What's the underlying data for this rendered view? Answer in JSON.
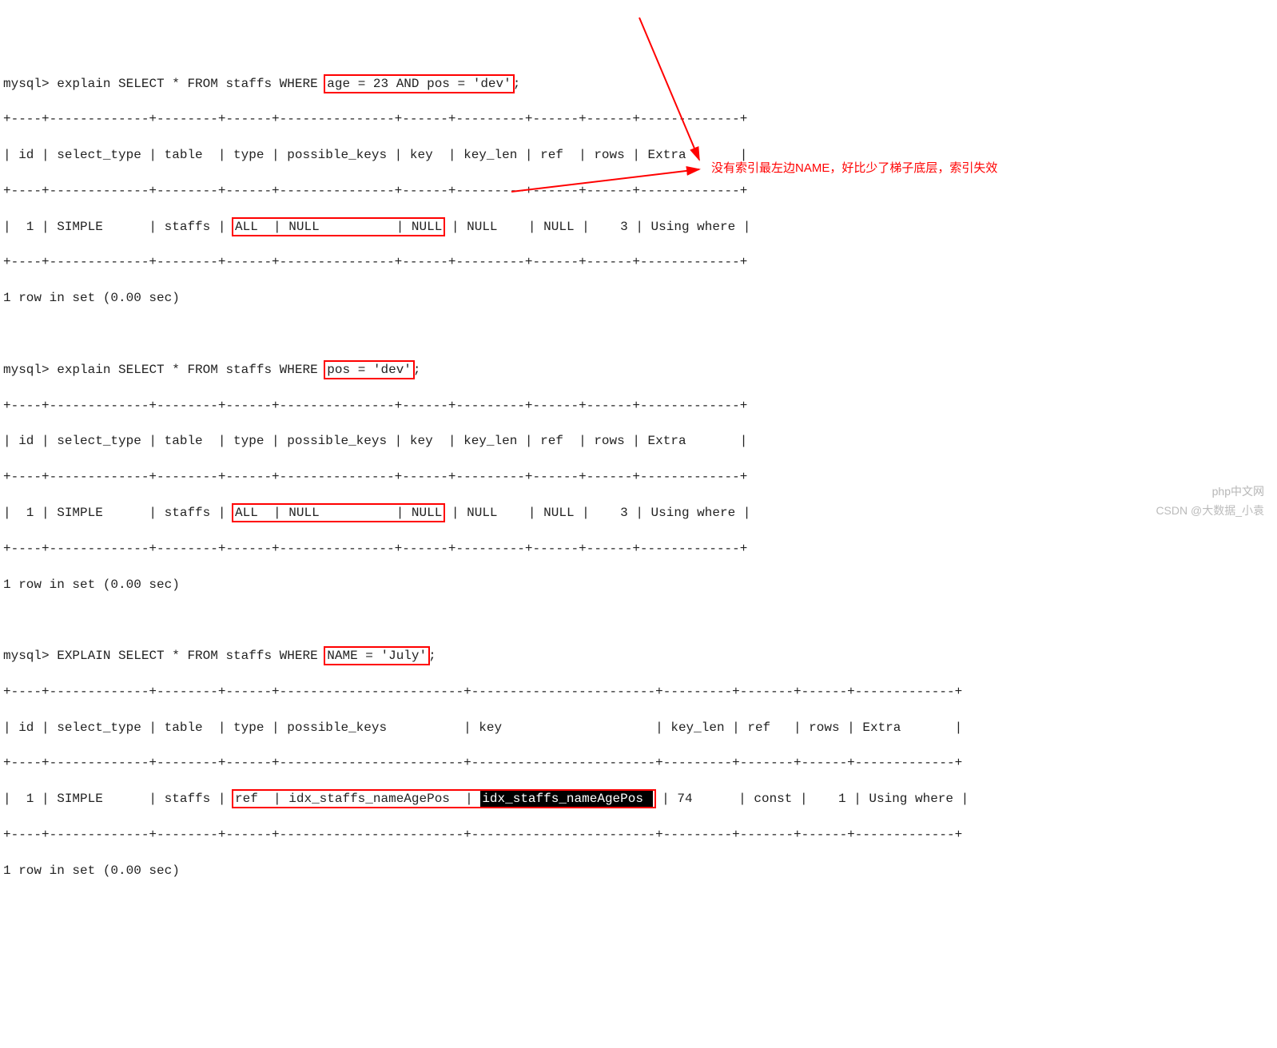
{
  "query1": {
    "prompt": "mysql> ",
    "prefix": "explain SELECT * FROM staffs WHERE ",
    "boxed": "age = 23 AND pos = 'dev'",
    "suffix": ";",
    "table_header": "| id | select_type | table  | type | possible_keys | key  | key_len | ref  | rows | Extra       |",
    "border": "+----+-------------+--------+------+---------------+------+---------+------+------+-------------+",
    "row_pre": "|  1 | SIMPLE      | staffs | ",
    "row_type": "ALL ",
    "row_mid1": " | ",
    "row_pk": "NULL         ",
    "row_mid2": " | ",
    "row_key": "NULL",
    "row_post": " | NULL    | NULL |    3 | Using where |",
    "footer": "1 row in set (0.00 sec)"
  },
  "query2": {
    "prompt": "mysql> ",
    "prefix": "explain SELECT * FROM staffs WHERE ",
    "boxed": "pos = 'dev'",
    "suffix": ";",
    "table_header": "| id | select_type | table  | type | possible_keys | key  | key_len | ref  | rows | Extra       |",
    "border": "+----+-------------+--------+------+---------------+------+---------+------+------+-------------+",
    "row_pre": "|  1 | SIMPLE      | staffs | ",
    "row_type": "ALL ",
    "row_mid1": " | ",
    "row_pk": "NULL         ",
    "row_mid2": " | ",
    "row_key": "NULL",
    "row_post": " | NULL    | NULL |    3 | Using where |",
    "footer": "1 row in set (0.00 sec)"
  },
  "query3": {
    "prompt": "mysql> ",
    "prefix": "EXPLAIN SELECT * FROM staffs WHERE ",
    "boxed": "NAME = 'July'",
    "suffix": ";",
    "table_header": "| id | select_type | table  | type | possible_keys          | key                    | key_len | ref   | rows | Extra       |",
    "border": "+----+-------------+--------+------+------------------------+------------------------+---------+-------+------+-------------+",
    "row_pre": "|  1 | SIMPLE      | staffs | ",
    "row_type": "ref ",
    "row_mid1": " | ",
    "row_pk": "idx_staffs_nameAgePos ",
    "row_mid2": " | ",
    "row_key": "idx_staffs_nameAgePos ",
    "row_post": " | 74      | const |    1 | Using where |",
    "footer": "1 row in set (0.00 sec)"
  },
  "annotation_text": "没有索引最左边NAME，好比少了梯子底层，索引失效",
  "watermark1": "php中文网",
  "watermark2": "CSDN @大数据_小袁"
}
